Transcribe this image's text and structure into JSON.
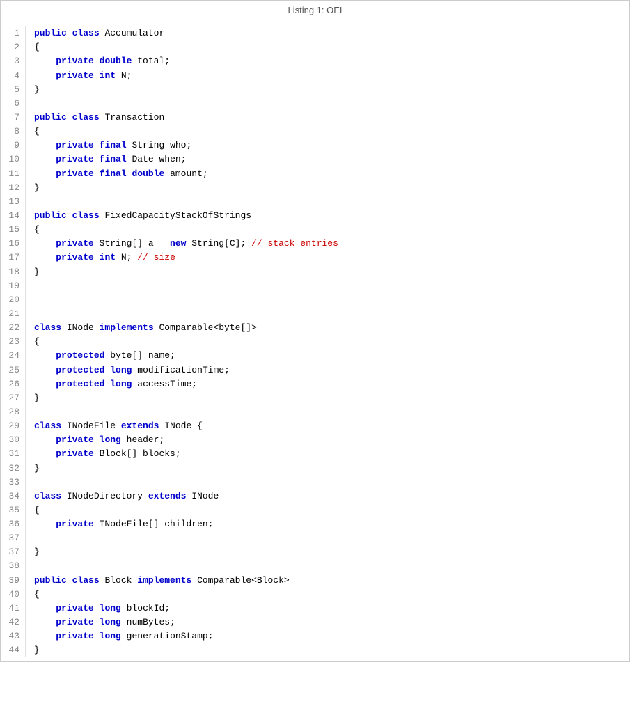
{
  "title": "Listing 1: OEI",
  "lines": [
    {
      "num": 1,
      "tokens": [
        {
          "t": "public",
          "c": "kw-blue"
        },
        {
          "t": " "
        },
        {
          "t": "class",
          "c": "kw-blue"
        },
        {
          "t": " Accumulator"
        }
      ]
    },
    {
      "num": 2,
      "tokens": [
        {
          "t": "{"
        }
      ]
    },
    {
      "num": 3,
      "tokens": [
        {
          "t": "    "
        },
        {
          "t": "private",
          "c": "kw-blue"
        },
        {
          "t": " "
        },
        {
          "t": "double",
          "c": "kw-blue"
        },
        {
          "t": " total;"
        }
      ]
    },
    {
      "num": 4,
      "tokens": [
        {
          "t": "    "
        },
        {
          "t": "private",
          "c": "kw-blue"
        },
        {
          "t": " "
        },
        {
          "t": "int",
          "c": "kw-blue"
        },
        {
          "t": " N;"
        }
      ]
    },
    {
      "num": 5,
      "tokens": [
        {
          "t": "}"
        }
      ]
    },
    {
      "num": 6,
      "tokens": []
    },
    {
      "num": 7,
      "tokens": [
        {
          "t": "public",
          "c": "kw-blue"
        },
        {
          "t": " "
        },
        {
          "t": "class",
          "c": "kw-blue"
        },
        {
          "t": " Transaction"
        }
      ]
    },
    {
      "num": 8,
      "tokens": [
        {
          "t": "{"
        }
      ]
    },
    {
      "num": 9,
      "tokens": [
        {
          "t": "    "
        },
        {
          "t": "private",
          "c": "kw-blue"
        },
        {
          "t": " "
        },
        {
          "t": "final",
          "c": "kw-blue"
        },
        {
          "t": " String who;"
        }
      ]
    },
    {
      "num": 10,
      "tokens": [
        {
          "t": "    "
        },
        {
          "t": "private",
          "c": "kw-blue"
        },
        {
          "t": " "
        },
        {
          "t": "final",
          "c": "kw-blue"
        },
        {
          "t": " Date when;"
        }
      ]
    },
    {
      "num": 11,
      "tokens": [
        {
          "t": "    "
        },
        {
          "t": "private",
          "c": "kw-blue"
        },
        {
          "t": " "
        },
        {
          "t": "final",
          "c": "kw-blue"
        },
        {
          "t": " "
        },
        {
          "t": "double",
          "c": "kw-blue"
        },
        {
          "t": " amount;"
        }
      ]
    },
    {
      "num": 12,
      "tokens": [
        {
          "t": "}"
        }
      ]
    },
    {
      "num": 13,
      "tokens": []
    },
    {
      "num": 14,
      "tokens": [
        {
          "t": "public",
          "c": "kw-blue"
        },
        {
          "t": " "
        },
        {
          "t": "class",
          "c": "kw-blue"
        },
        {
          "t": " FixedCapacityStackOfStrings"
        }
      ]
    },
    {
      "num": 15,
      "tokens": [
        {
          "t": "{"
        }
      ]
    },
    {
      "num": 16,
      "tokens": [
        {
          "t": "    "
        },
        {
          "t": "private",
          "c": "kw-blue"
        },
        {
          "t": " String[] a = "
        },
        {
          "t": "new",
          "c": "kw-blue"
        },
        {
          "t": " String[C]; "
        },
        {
          "t": "// stack entries",
          "c": "comment"
        }
      ]
    },
    {
      "num": 17,
      "tokens": [
        {
          "t": "    "
        },
        {
          "t": "private",
          "c": "kw-blue"
        },
        {
          "t": " "
        },
        {
          "t": "int",
          "c": "kw-blue"
        },
        {
          "t": " N; "
        },
        {
          "t": "// size",
          "c": "comment"
        }
      ]
    },
    {
      "num": 18,
      "tokens": [
        {
          "t": "}"
        }
      ]
    },
    {
      "num": 19,
      "tokens": []
    },
    {
      "num": 20,
      "tokens": []
    },
    {
      "num": 21,
      "tokens": []
    },
    {
      "num": 22,
      "tokens": [
        {
          "t": "class",
          "c": "kw-blue"
        },
        {
          "t": " INode "
        },
        {
          "t": "implements",
          "c": "kw-blue"
        },
        {
          "t": " Comparable<byte[]>"
        }
      ]
    },
    {
      "num": 23,
      "tokens": [
        {
          "t": "{"
        }
      ]
    },
    {
      "num": 24,
      "tokens": [
        {
          "t": "    "
        },
        {
          "t": "protected",
          "c": "kw-blue"
        },
        {
          "t": " byte[] name;"
        }
      ]
    },
    {
      "num": 25,
      "tokens": [
        {
          "t": "    "
        },
        {
          "t": "protected",
          "c": "kw-blue"
        },
        {
          "t": " "
        },
        {
          "t": "long",
          "c": "kw-blue"
        },
        {
          "t": " modificationTime;"
        }
      ]
    },
    {
      "num": 26,
      "tokens": [
        {
          "t": "    "
        },
        {
          "t": "protected",
          "c": "kw-blue"
        },
        {
          "t": " "
        },
        {
          "t": "long",
          "c": "kw-blue"
        },
        {
          "t": " accessTime;"
        }
      ]
    },
    {
      "num": 27,
      "tokens": [
        {
          "t": "}"
        }
      ]
    },
    {
      "num": 28,
      "tokens": []
    },
    {
      "num": 29,
      "tokens": [
        {
          "t": "class",
          "c": "kw-blue"
        },
        {
          "t": " INodeFile "
        },
        {
          "t": "extends",
          "c": "kw-blue"
        },
        {
          "t": " INode {"
        }
      ]
    },
    {
      "num": 30,
      "tokens": [
        {
          "t": "    "
        },
        {
          "t": "private",
          "c": "kw-blue"
        },
        {
          "t": " "
        },
        {
          "t": "long",
          "c": "kw-blue"
        },
        {
          "t": " header;"
        }
      ]
    },
    {
      "num": 31,
      "tokens": [
        {
          "t": "    "
        },
        {
          "t": "private",
          "c": "kw-blue"
        },
        {
          "t": " Block[] blocks;"
        }
      ]
    },
    {
      "num": 32,
      "tokens": [
        {
          "t": "}"
        }
      ]
    },
    {
      "num": 33,
      "tokens": []
    },
    {
      "num": 34,
      "tokens": [
        {
          "t": "class",
          "c": "kw-blue"
        },
        {
          "t": " INodeDirectory "
        },
        {
          "t": "extends",
          "c": "kw-blue"
        },
        {
          "t": " INode"
        }
      ]
    },
    {
      "num": 35,
      "tokens": [
        {
          "t": "{"
        }
      ]
    },
    {
      "num": 36,
      "tokens": [
        {
          "t": "    "
        },
        {
          "t": "private",
          "c": "kw-blue"
        },
        {
          "t": " INodeFile[] children;"
        }
      ]
    },
    {
      "num": 37,
      "tokens": []
    },
    {
      "num": 37,
      "tokens": [
        {
          "t": "}"
        }
      ]
    },
    {
      "num": 38,
      "tokens": []
    },
    {
      "num": 39,
      "tokens": [
        {
          "t": "public",
          "c": "kw-blue"
        },
        {
          "t": " "
        },
        {
          "t": "class",
          "c": "kw-blue"
        },
        {
          "t": " Block "
        },
        {
          "t": "implements",
          "c": "kw-blue"
        },
        {
          "t": " Comparable<Block>"
        }
      ]
    },
    {
      "num": 40,
      "tokens": [
        {
          "t": "{"
        }
      ]
    },
    {
      "num": 41,
      "tokens": [
        {
          "t": "    "
        },
        {
          "t": "private",
          "c": "kw-blue"
        },
        {
          "t": " "
        },
        {
          "t": "long",
          "c": "kw-blue"
        },
        {
          "t": " blockId;"
        }
      ]
    },
    {
      "num": 42,
      "tokens": [
        {
          "t": "    "
        },
        {
          "t": "private",
          "c": "kw-blue"
        },
        {
          "t": " "
        },
        {
          "t": "long",
          "c": "kw-blue"
        },
        {
          "t": " numBytes;"
        }
      ]
    },
    {
      "num": 43,
      "tokens": [
        {
          "t": "    "
        },
        {
          "t": "private",
          "c": "kw-blue"
        },
        {
          "t": " "
        },
        {
          "t": "long",
          "c": "kw-blue"
        },
        {
          "t": " generationStamp;"
        }
      ]
    },
    {
      "num": 44,
      "tokens": [
        {
          "t": "}"
        }
      ]
    }
  ]
}
